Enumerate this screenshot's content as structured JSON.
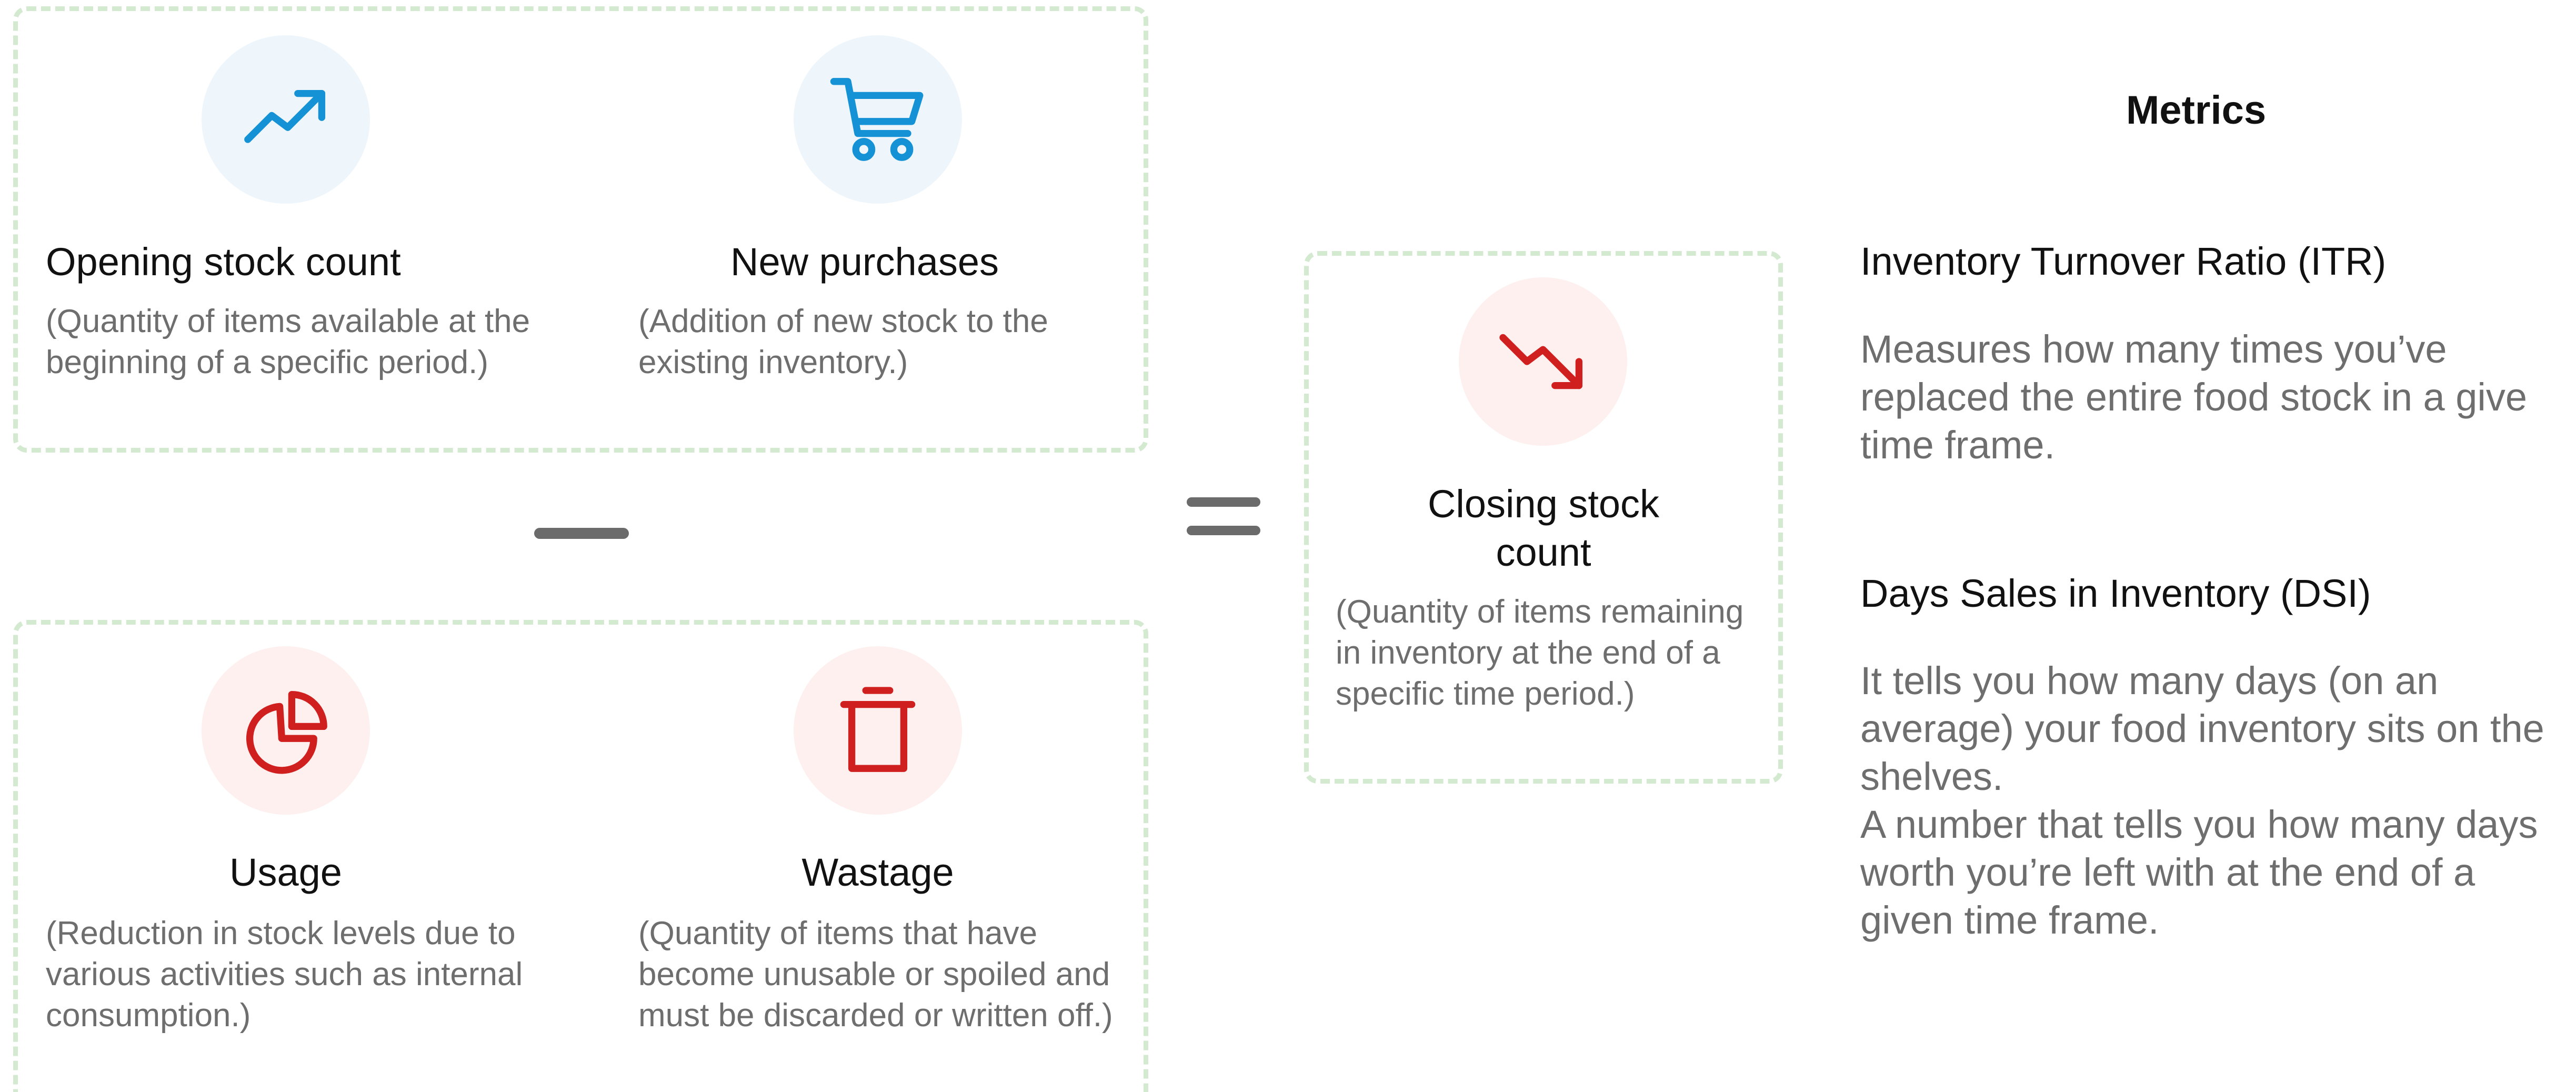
{
  "inputs_top": {
    "opening": {
      "icon": "trending-up-icon",
      "title": "Opening stock count",
      "description": "(Quantity of items available at the beginning of a specific period.)"
    },
    "purchases": {
      "icon": "shopping-cart-icon",
      "title": "New purchases",
      "description": "(Addition of new stock to the existing inventory.)"
    }
  },
  "inputs_bottom": {
    "usage": {
      "icon": "pie-chart-icon",
      "title": "Usage",
      "description": "(Reduction in stock levels due to various activities such as internal consumption.)"
    },
    "wastage": {
      "icon": "trash-icon",
      "title": "Wastage",
      "description": "(Quantity of items that have become unusable or spoiled and must be discarded or written off.)"
    }
  },
  "result": {
    "icon": "trending-down-icon",
    "title": "Closing stock count",
    "description": "(Quantity of items remaining in inventory at the end of a specific time period.)"
  },
  "metrics": {
    "heading": "Metrics",
    "itr": {
      "title": "Inventory Turnover Ratio (ITR)",
      "description": "Measures how many times you’ve replaced the entire food stock in a give time frame."
    },
    "dsi": {
      "title": "Days Sales in Inventory (DSI)",
      "description_1": "It tells you how many days (on an average) your food inventory sits on the shelves.",
      "description_2": "A number that tells you how many days worth you’re left with at the end of a given time frame."
    }
  },
  "colors": {
    "accent_blue": "#1592d6",
    "accent_red": "#d01f1f",
    "dashed_border": "#d3ead0",
    "operator": "#6b6b6b"
  }
}
